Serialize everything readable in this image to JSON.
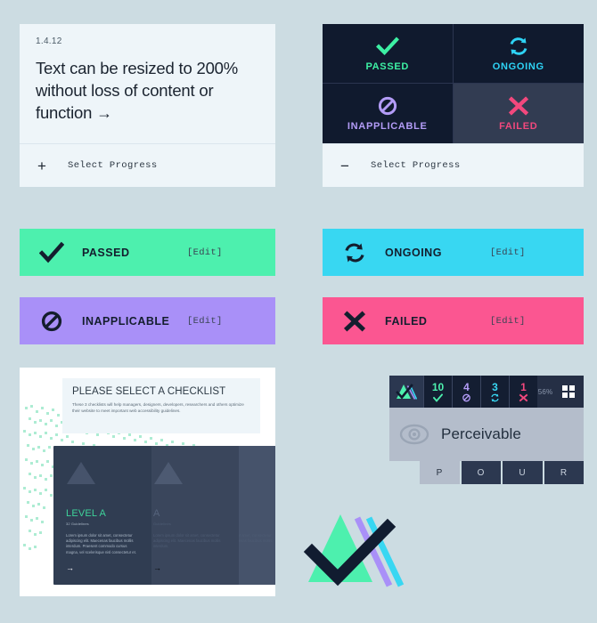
{
  "criterion_card": {
    "number": "1.4.12",
    "title": "Text can be resized to 200% without loss of content or function",
    "arrow": "→",
    "footer": {
      "sign": "+",
      "label": "Select Progress"
    }
  },
  "status_card": {
    "quadrants": [
      {
        "label": "PASSED",
        "icon": "check-icon",
        "state": "normal"
      },
      {
        "label": "ONGOING",
        "icon": "refresh-icon",
        "state": "normal"
      },
      {
        "label": "INAPPLICABLE",
        "icon": "no-entry-icon",
        "state": "normal"
      },
      {
        "label": "FAILED",
        "icon": "cross-icon",
        "state": "hovered"
      }
    ],
    "footer": {
      "sign": "−",
      "label": "Select Progress"
    }
  },
  "status_bars": [
    {
      "label": "PASSED",
      "edit": "[Edit]",
      "icon": "check-icon",
      "color": "#4df0ae"
    },
    {
      "label": "ONGOING",
      "edit": "[Edit]",
      "icon": "refresh-icon",
      "color": "#38d7f2"
    },
    {
      "label": "INAPPLICABLE",
      "edit": "[Edit]",
      "icon": "no-entry-icon",
      "color": "#a990f8"
    },
    {
      "label": "FAILED",
      "edit": "[Edit]",
      "icon": "cross-icon",
      "color": "#fb5691"
    }
  ],
  "checklist_panel": {
    "heading": "PLEASE SELECT A CHECKLIST",
    "description": "These 3 checklists will help managers, designers, developers, researchers and others optimize their website to meet important web accessibility guidelines.",
    "cards": [
      {
        "level": "LEVEL A",
        "guidelines": "32 Guidelines",
        "body": "Lorem ipsum dolor sit amet, consectetur adipiscing elit. Maecenas faucibus mollis interdum. Praesent commodo cursus magna, vel scelerisque nisl consectetur et.",
        "arrow": "→"
      },
      {
        "level": "A",
        "guidelines": "Guidelines",
        "body": "Lorem ipsum dolor sit amet, consectetur adipiscing elit. Maecenas faucibus mollis interdum.",
        "arrow": "→"
      },
      {
        "level": "AA",
        "guidelines": "Guidelines",
        "body": "Lorem ipsum dolor sit amet, consectetur adipiscing elit. Maecenas faucibus mollis interdum.",
        "arrow": "→"
      }
    ]
  },
  "stats_panel": {
    "counts": [
      {
        "value": "10",
        "icon": "check-icon",
        "status": "passed"
      },
      {
        "value": "4",
        "icon": "no-entry-icon",
        "status": "inapplicable"
      },
      {
        "value": "3",
        "icon": "refresh-icon",
        "status": "ongoing"
      },
      {
        "value": "1",
        "icon": "cross-icon",
        "status": "failed"
      }
    ],
    "percent": "56%",
    "grid_button": "grid-view-icon",
    "principle": "Perceivable",
    "principle_icon": "eye-icon",
    "pour_tabs": [
      {
        "label": "P",
        "active": true
      },
      {
        "label": "O",
        "active": false
      },
      {
        "label": "U",
        "active": false
      },
      {
        "label": "R",
        "active": false
      }
    ]
  },
  "brand": {
    "mark": "checkmark-triangle-logo"
  }
}
